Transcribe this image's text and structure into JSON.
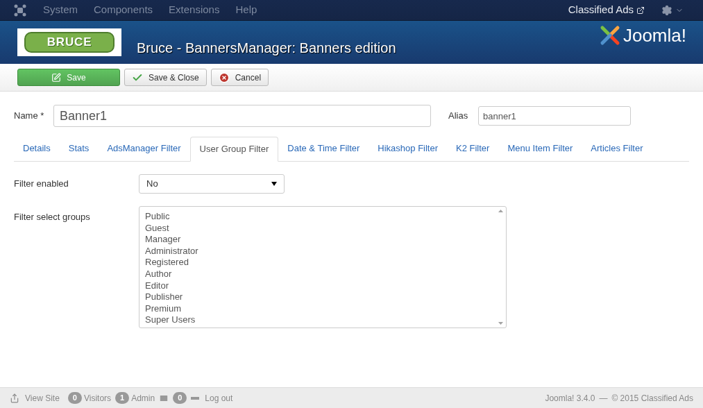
{
  "top_menu": [
    {
      "label": "System"
    },
    {
      "label": "Components"
    },
    {
      "label": "Extensions"
    },
    {
      "label": "Help"
    }
  ],
  "site_link": "Classified Ads",
  "header": {
    "logo_text": "BRUCE",
    "title": "Bruce - BannersManager: Banners edition",
    "brand": "Joomla!"
  },
  "toolbar": [
    {
      "kind": "save",
      "label": "Save"
    },
    {
      "kind": "check",
      "label": "Save & Close"
    },
    {
      "kind": "cancel",
      "label": "Cancel"
    }
  ],
  "name_field": {
    "label": "Name *",
    "value": "Banner1"
  },
  "alias_field": {
    "label": "Alias",
    "value": "banner1"
  },
  "tabs": [
    {
      "label": "Details",
      "selected": false
    },
    {
      "label": "Stats",
      "selected": false
    },
    {
      "label": "AdsManager Filter",
      "selected": false
    },
    {
      "label": "User Group Filter",
      "selected": true
    },
    {
      "label": "Date & Time Filter",
      "selected": false
    },
    {
      "label": "Hikashop Filter",
      "selected": false
    },
    {
      "label": "K2 Filter",
      "selected": false
    },
    {
      "label": "Menu Item Filter",
      "selected": false
    },
    {
      "label": "Articles Filter",
      "selected": false
    }
  ],
  "filter_enabled": {
    "label": "Filter enabled",
    "value": "No"
  },
  "filter_groups": {
    "label": "Filter select groups",
    "options": [
      {
        "label": "Public",
        "selected": false
      },
      {
        "label": "Guest",
        "selected": false
      },
      {
        "label": "Manager",
        "selected": false
      },
      {
        "label": "Administrator",
        "selected": false
      },
      {
        "label": "Registered",
        "selected": false
      },
      {
        "label": "Author",
        "selected": false
      },
      {
        "label": "Editor",
        "selected": false
      },
      {
        "label": "Publisher",
        "selected": false
      },
      {
        "label": "Premium",
        "selected": false
      },
      {
        "label": "Super Users",
        "selected": false
      }
    ]
  },
  "status_bar": {
    "view_site": "View Site",
    "visitors_count": "0",
    "visitors": "Visitors",
    "admin_count": "1",
    "admin": "Admin",
    "messages_count": "0",
    "logout": "Log out",
    "version": "Joomla! 3.4.0",
    "separator": "—",
    "copyright": "© 2015 Classified Ads"
  }
}
